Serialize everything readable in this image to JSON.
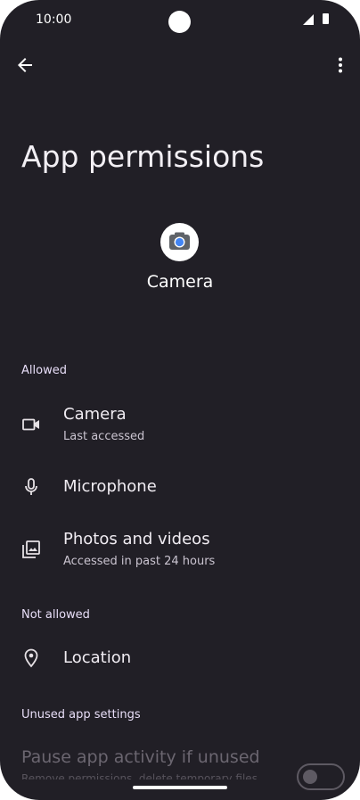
{
  "status_bar": {
    "time": "10:00"
  },
  "page": {
    "title": "App permissions"
  },
  "app": {
    "name": "Camera"
  },
  "sections": {
    "allowed": "Allowed",
    "not_allowed": "Not allowed",
    "unused": "Unused app settings"
  },
  "permissions": {
    "camera": {
      "label": "Camera",
      "subtitle": "Last accessed"
    },
    "microphone": {
      "label": "Microphone"
    },
    "photos": {
      "label": "Photos and videos",
      "subtitle": "Accessed in past 24 hours"
    },
    "location": {
      "label": "Location"
    }
  },
  "unused_settings": {
    "pause_label": "Pause app activity if unused",
    "pause_sub": "Remove permissions, delete temporary files",
    "pause_enabled": false
  },
  "icons": {
    "back": "arrow-back-icon",
    "more": "more-vert-icon",
    "camera": "videocam-icon",
    "microphone": "mic-icon",
    "photos": "photo-library-icon",
    "location": "location-pin-icon"
  },
  "colors": {
    "background": "#211f26",
    "section_header": "#e8def8",
    "camera_icon_blue": "#4285f4"
  }
}
